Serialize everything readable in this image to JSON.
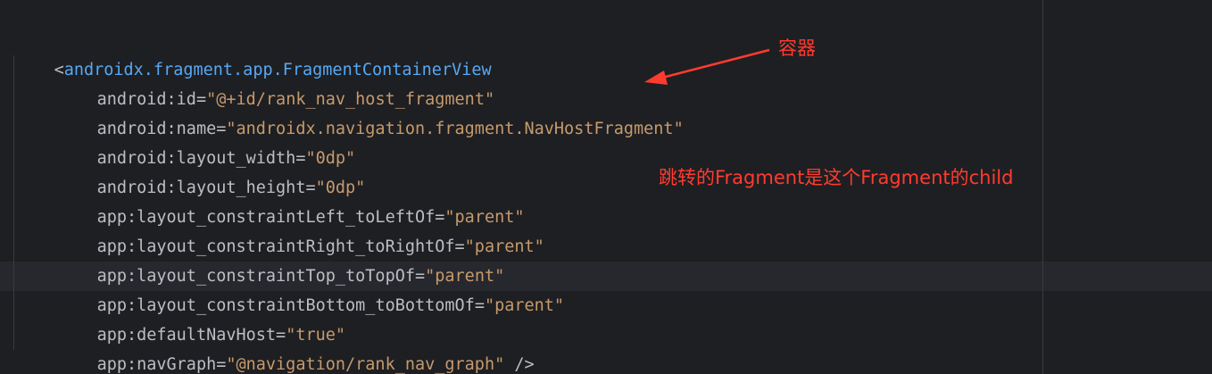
{
  "code": {
    "open_bracket": "<",
    "tag_name": "androidx.fragment.app.FragmentContainerView",
    "attributes": [
      {
        "name": "android:id",
        "value": "\"@+id/rank_nav_host_fragment\""
      },
      {
        "name": "android:name",
        "value": "\"androidx.navigation.fragment.NavHostFragment\""
      },
      {
        "name": "android:layout_width",
        "value": "\"0dp\""
      },
      {
        "name": "android:layout_height",
        "value": "\"0dp\""
      },
      {
        "name": "app:layout_constraintLeft_toLeftOf",
        "value": "\"parent\""
      },
      {
        "name": "app:layout_constraintRight_toRightOf",
        "value": "\"parent\""
      },
      {
        "name": "app:layout_constraintTop_toTopOf",
        "value": "\"parent\""
      },
      {
        "name": "app:layout_constraintBottom_toBottomOf",
        "value": "\"parent\""
      },
      {
        "name": "app:defaultNavHost",
        "value": "\"true\""
      },
      {
        "name": "app:navGraph",
        "value": "\"@navigation/rank_nav_graph\""
      }
    ],
    "equals": "=",
    "close_tag": " />"
  },
  "annotations": {
    "container_label": "容器",
    "child_note": "跳转的Fragment是这个Fragment的child"
  },
  "colors": {
    "background": "#1e1f22",
    "tag": "#56a8f5",
    "attribute_name": "#bcbec4",
    "string_value": "#c69a6d",
    "annotation": "#ff3b30",
    "current_line": "#26282e"
  }
}
